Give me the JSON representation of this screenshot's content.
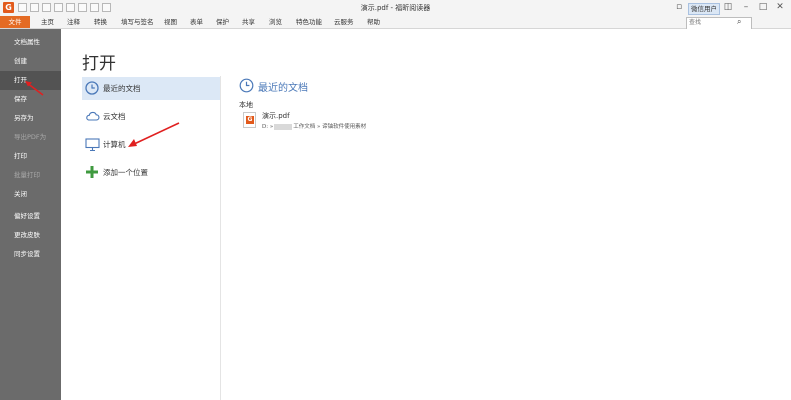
{
  "window": {
    "title": "演示.pdf - 福昕阅读器",
    "user_button": "微信用户",
    "search_placeholder": "查找"
  },
  "menubar": {
    "items": [
      "文件",
      "主页",
      "注释",
      "转换",
      "填写与签名",
      "视图",
      "表单",
      "保护",
      "共享",
      "浏览",
      "特色功能",
      "云服务",
      "帮助"
    ],
    "active_index": 0
  },
  "sidebar": {
    "items": [
      {
        "label": "文档属性",
        "state": "normal"
      },
      {
        "label": "创建",
        "state": "normal"
      },
      {
        "label": "打开",
        "state": "active"
      },
      {
        "label": "保存",
        "state": "normal"
      },
      {
        "label": "另存为",
        "state": "normal"
      },
      {
        "label": "导出PDF为",
        "state": "disabled"
      },
      {
        "label": "打印",
        "state": "normal"
      },
      {
        "label": "批量打印",
        "state": "disabled"
      },
      {
        "label": "关闭",
        "state": "normal"
      },
      {
        "label": "偏好设置",
        "state": "normal"
      },
      {
        "label": "更改皮肤",
        "state": "normal"
      },
      {
        "label": "同步设置",
        "state": "normal"
      }
    ]
  },
  "open_page": {
    "title": "打开",
    "locations": [
      {
        "label": "最近的文档",
        "icon": "clock-icon",
        "selected": true
      },
      {
        "label": "云文档",
        "icon": "cloud-icon",
        "selected": false
      },
      {
        "label": "计算机",
        "icon": "computer-icon",
        "selected": false
      },
      {
        "label": "添加一个位置",
        "icon": "plus-icon",
        "selected": false
      }
    ]
  },
  "recent": {
    "title": "最近的文档",
    "group": "本地",
    "files": [
      {
        "name": "演示.pdf",
        "path_prefix": "D: »",
        "path_suffix": "工作文档 » 谛铀软件使用素材"
      }
    ]
  },
  "colors": {
    "accent": "#e46b24",
    "sidebar_bg": "#6b6b6b",
    "sidebar_active": "#535353",
    "selected_location": "#dce8f6",
    "recent_title": "#4a78b8",
    "annotation_arrow": "#e02020"
  }
}
